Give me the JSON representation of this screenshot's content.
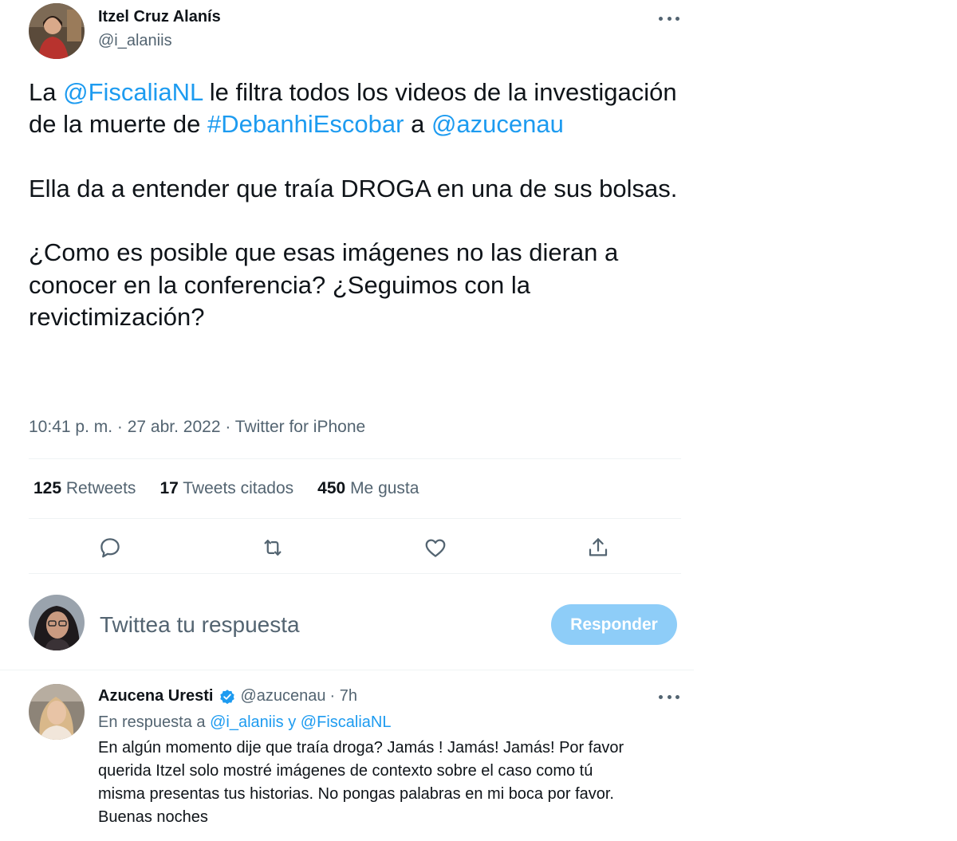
{
  "tweet": {
    "author": {
      "name": "Itzel Cruz Alanís",
      "handle": "@i_alaniis"
    },
    "text": {
      "p1": [
        {
          "t": "La ",
          "link": false
        },
        {
          "t": "@FiscaliaNL",
          "link": true
        },
        {
          "t": " le filtra todos los videos de la investigación de la muerte de ",
          "link": false
        },
        {
          "t": "#DebanhiEscobar",
          "link": true
        },
        {
          "t": " a ",
          "link": false
        },
        {
          "t": "@azucenau",
          "link": true
        }
      ],
      "p2": "Ella da a entender que traía DROGA en una de sus bolsas.",
      "p3": "¿Como es posible que esas imágenes no las dieran a conocer en la conferencia? ¿Seguimos con la revictimización?"
    },
    "meta": "10:41 p. m. · 27 abr. 2022 · Twitter for iPhone",
    "stats": {
      "retweets_count": "125",
      "retweets_label": "Retweets",
      "quotes_count": "17",
      "quotes_label": "Tweets citados",
      "likes_count": "450",
      "likes_label": "Me gusta"
    },
    "actions": [
      "reply-icon",
      "retweet-icon",
      "like-icon",
      "share-icon"
    ]
  },
  "composer": {
    "placeholder": "Twittea tu respuesta",
    "button_label": "Responder"
  },
  "reply": {
    "author_name": "Azucena Uresti",
    "verified": true,
    "handle": "@azucenau",
    "time": "· 7h",
    "in_reply_prefix": "En respuesta a ",
    "in_reply_user1": "@i_alaniis",
    "in_reply_sep": " y ",
    "in_reply_user2": "@FiscaliaNL",
    "text_lines": [
      "En algún momento dije que traía droga? Jamás ! Jamás! Jamás! Por favor",
      "querida Itzel solo mostré imágenes de contexto sobre el caso como tú",
      "misma presentas tus historias. No pongas palabras en mi boca por favor.",
      "Buenas noches"
    ]
  },
  "colors": {
    "link": "#1d9bf0",
    "text": "#0f1419",
    "secondary": "#536471",
    "button_disabled": "#8ecdf8"
  }
}
